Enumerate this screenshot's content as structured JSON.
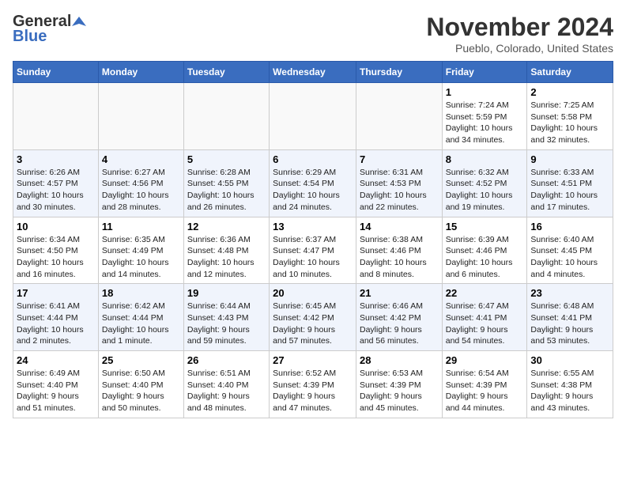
{
  "logo": {
    "line1": "General",
    "line2": "Blue"
  },
  "header": {
    "title": "November 2024",
    "location": "Pueblo, Colorado, United States"
  },
  "weekdays": [
    "Sunday",
    "Monday",
    "Tuesday",
    "Wednesday",
    "Thursday",
    "Friday",
    "Saturday"
  ],
  "weeks": [
    [
      {
        "day": "",
        "info": ""
      },
      {
        "day": "",
        "info": ""
      },
      {
        "day": "",
        "info": ""
      },
      {
        "day": "",
        "info": ""
      },
      {
        "day": "",
        "info": ""
      },
      {
        "day": "1",
        "info": "Sunrise: 7:24 AM\nSunset: 5:59 PM\nDaylight: 10 hours\nand 34 minutes."
      },
      {
        "day": "2",
        "info": "Sunrise: 7:25 AM\nSunset: 5:58 PM\nDaylight: 10 hours\nand 32 minutes."
      }
    ],
    [
      {
        "day": "3",
        "info": "Sunrise: 6:26 AM\nSunset: 4:57 PM\nDaylight: 10 hours\nand 30 minutes."
      },
      {
        "day": "4",
        "info": "Sunrise: 6:27 AM\nSunset: 4:56 PM\nDaylight: 10 hours\nand 28 minutes."
      },
      {
        "day": "5",
        "info": "Sunrise: 6:28 AM\nSunset: 4:55 PM\nDaylight: 10 hours\nand 26 minutes."
      },
      {
        "day": "6",
        "info": "Sunrise: 6:29 AM\nSunset: 4:54 PM\nDaylight: 10 hours\nand 24 minutes."
      },
      {
        "day": "7",
        "info": "Sunrise: 6:31 AM\nSunset: 4:53 PM\nDaylight: 10 hours\nand 22 minutes."
      },
      {
        "day": "8",
        "info": "Sunrise: 6:32 AM\nSunset: 4:52 PM\nDaylight: 10 hours\nand 19 minutes."
      },
      {
        "day": "9",
        "info": "Sunrise: 6:33 AM\nSunset: 4:51 PM\nDaylight: 10 hours\nand 17 minutes."
      }
    ],
    [
      {
        "day": "10",
        "info": "Sunrise: 6:34 AM\nSunset: 4:50 PM\nDaylight: 10 hours\nand 16 minutes."
      },
      {
        "day": "11",
        "info": "Sunrise: 6:35 AM\nSunset: 4:49 PM\nDaylight: 10 hours\nand 14 minutes."
      },
      {
        "day": "12",
        "info": "Sunrise: 6:36 AM\nSunset: 4:48 PM\nDaylight: 10 hours\nand 12 minutes."
      },
      {
        "day": "13",
        "info": "Sunrise: 6:37 AM\nSunset: 4:47 PM\nDaylight: 10 hours\nand 10 minutes."
      },
      {
        "day": "14",
        "info": "Sunrise: 6:38 AM\nSunset: 4:46 PM\nDaylight: 10 hours\nand 8 minutes."
      },
      {
        "day": "15",
        "info": "Sunrise: 6:39 AM\nSunset: 4:46 PM\nDaylight: 10 hours\nand 6 minutes."
      },
      {
        "day": "16",
        "info": "Sunrise: 6:40 AM\nSunset: 4:45 PM\nDaylight: 10 hours\nand 4 minutes."
      }
    ],
    [
      {
        "day": "17",
        "info": "Sunrise: 6:41 AM\nSunset: 4:44 PM\nDaylight: 10 hours\nand 2 minutes."
      },
      {
        "day": "18",
        "info": "Sunrise: 6:42 AM\nSunset: 4:44 PM\nDaylight: 10 hours\nand 1 minute."
      },
      {
        "day": "19",
        "info": "Sunrise: 6:44 AM\nSunset: 4:43 PM\nDaylight: 9 hours\nand 59 minutes."
      },
      {
        "day": "20",
        "info": "Sunrise: 6:45 AM\nSunset: 4:42 PM\nDaylight: 9 hours\nand 57 minutes."
      },
      {
        "day": "21",
        "info": "Sunrise: 6:46 AM\nSunset: 4:42 PM\nDaylight: 9 hours\nand 56 minutes."
      },
      {
        "day": "22",
        "info": "Sunrise: 6:47 AM\nSunset: 4:41 PM\nDaylight: 9 hours\nand 54 minutes."
      },
      {
        "day": "23",
        "info": "Sunrise: 6:48 AM\nSunset: 4:41 PM\nDaylight: 9 hours\nand 53 minutes."
      }
    ],
    [
      {
        "day": "24",
        "info": "Sunrise: 6:49 AM\nSunset: 4:40 PM\nDaylight: 9 hours\nand 51 minutes."
      },
      {
        "day": "25",
        "info": "Sunrise: 6:50 AM\nSunset: 4:40 PM\nDaylight: 9 hours\nand 50 minutes."
      },
      {
        "day": "26",
        "info": "Sunrise: 6:51 AM\nSunset: 4:40 PM\nDaylight: 9 hours\nand 48 minutes."
      },
      {
        "day": "27",
        "info": "Sunrise: 6:52 AM\nSunset: 4:39 PM\nDaylight: 9 hours\nand 47 minutes."
      },
      {
        "day": "28",
        "info": "Sunrise: 6:53 AM\nSunset: 4:39 PM\nDaylight: 9 hours\nand 45 minutes."
      },
      {
        "day": "29",
        "info": "Sunrise: 6:54 AM\nSunset: 4:39 PM\nDaylight: 9 hours\nand 44 minutes."
      },
      {
        "day": "30",
        "info": "Sunrise: 6:55 AM\nSunset: 4:38 PM\nDaylight: 9 hours\nand 43 minutes."
      }
    ]
  ]
}
